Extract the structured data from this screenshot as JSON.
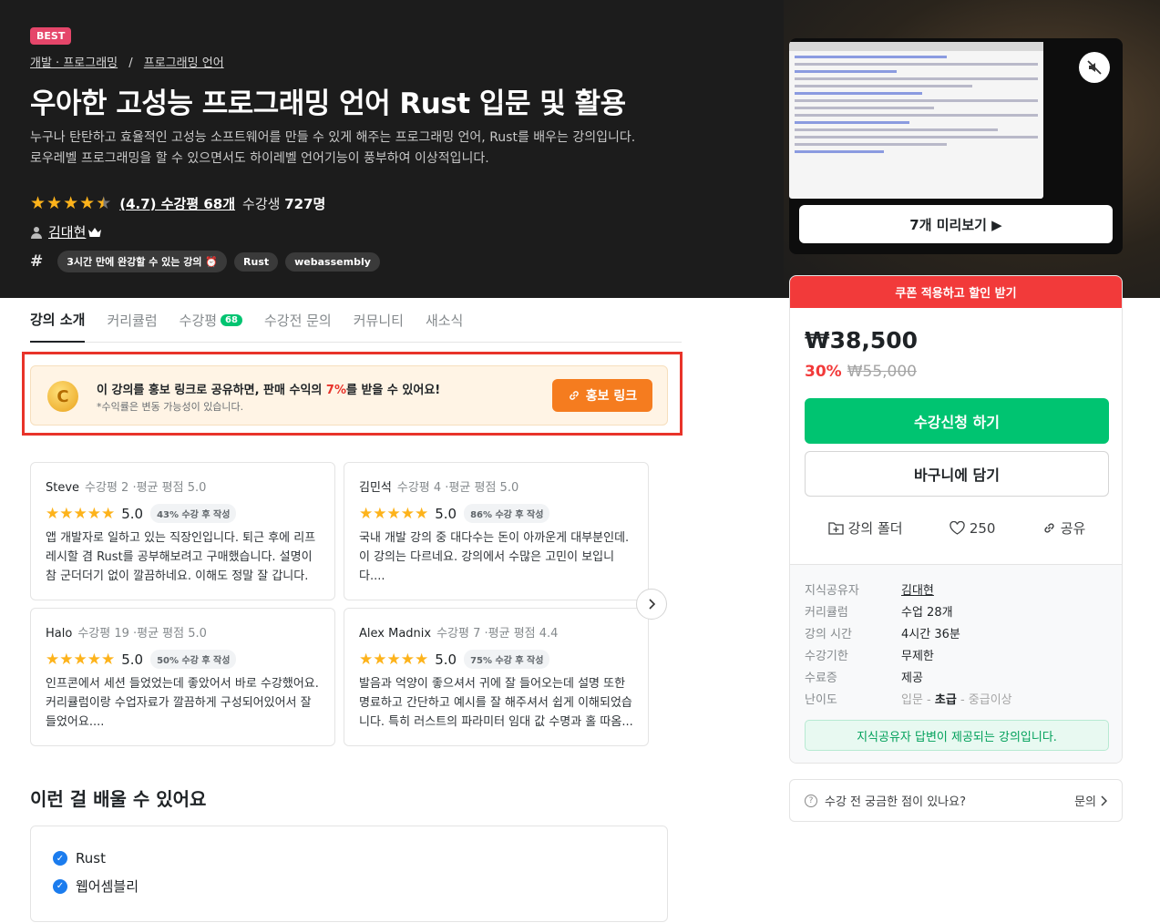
{
  "hero": {
    "badge": "BEST",
    "breadcrumb": [
      "개발 · 프로그래밍",
      "프로그래밍 언어"
    ],
    "breadcrumb_sep": "/",
    "title": "우아한 고성능 프로그래밍 언어 Rust 입문 및 활용",
    "description": "누구나 탄탄하고 효율적인 고성능 소프트웨어를 만들 수 있게 해주는 프로그래밍 언어, Rust를 배우는 강의입니다. 로우레벨 프로그래밍을 할 수 있으면서도 하이레벨 언어기능이 풍부하여 이상적입니다.",
    "rating": 4.7,
    "rating_text": "(4.7) 수강평 68개",
    "students_label": "수강생",
    "students_count": "727명",
    "instructor": "김대현",
    "crown_icon": "crown-icon",
    "tags": [
      "3시간 만에 완강할 수 있는 강의 ⏰",
      "Rust",
      "webassembly"
    ]
  },
  "video": {
    "preview_label": "7개 미리보기 ▶",
    "mute_icon": "mute-icon"
  },
  "tabs": [
    {
      "label": "강의 소개"
    },
    {
      "label": "커리큘럼"
    },
    {
      "label": "수강평",
      "count": "68"
    },
    {
      "label": "수강전 문의"
    },
    {
      "label": "커뮤니티"
    },
    {
      "label": "새소식"
    }
  ],
  "promo": {
    "text_before": "이 강의를 홍보 링크로 공유하면, 판매 수익의 ",
    "pct": "7%",
    "text_after": "를 받을 수 있어요!",
    "sub": "*수익률은 변동 가능성이 있습니다.",
    "button": "홍보 링크",
    "highlight_color": "#e8332a"
  },
  "reviews": [
    {
      "name": "Steve",
      "meta": "수강평 2 ·평균 평점 5.0",
      "score": "5.0",
      "pill": "43% 수강 후 작성",
      "body": "앱 개발자로 일하고 있는 직장인입니다. 퇴근 후에 리프레시할 겸 Rust를 공부해보려고 구매했습니다. 설명이 참 군더더기 없이 깔끔하네요. 이해도 정말 잘 갑니다. ..."
    },
    {
      "name": "김민석",
      "meta": "수강평 4 ·평균 평점 5.0",
      "score": "5.0",
      "pill": "86% 수강 후 작성",
      "body": "국내 개발 강의 중 대다수는 돈이 아까운게 대부분인데. 이 강의는 다르네요. 강의에서 수많은 고민이 보입니다...."
    },
    {
      "name": "Halo",
      "meta": "수강평 19 ·평균 평점 5.0",
      "score": "5.0",
      "pill": "50% 수강 후 작성",
      "body": "인프콘에서 세션 들었었는데 좋았어서 바로 수강했어요. 커리큘럼이랑 수업자료가 깔끔하게 구성되어있어서 잘 들었어요...."
    },
    {
      "name": "Alex Madnix",
      "meta": "수강평 7 ·평균 평점 4.4",
      "score": "5.0",
      "pill": "75% 수강 후 작성",
      "body": "발음과 억양이 좋으셔서 귀에 잘 들어오는데 설명 또한 명료하고 간단하고 예시를 잘 해주셔서 쉽게 이해되었습니다. 특히 러스트의 파라미터 임대 값 수명과 홀 따옴..."
    }
  ],
  "learn": {
    "title": "이런 걸 배울 수 있어요",
    "items": [
      "Rust",
      "웹어셈블리"
    ]
  },
  "sidebar": {
    "coupon": "쿠폰 적용하고 할인 받기",
    "price": "₩38,500",
    "discount_pct": "30%",
    "original_price": "₩55,000",
    "enroll": "수강신청 하기",
    "cart": "바구니에 담기",
    "folder": "강의 폴더",
    "likes": "250",
    "share": "공유",
    "info": [
      {
        "k": "지식공유자",
        "v": "김대현"
      },
      {
        "k": "커리큘럼",
        "v": "수업 28개"
      },
      {
        "k": "강의 시간",
        "v": "4시간 36분"
      },
      {
        "k": "수강기한",
        "v": "무제한"
      },
      {
        "k": "수료증",
        "v": "제공"
      }
    ],
    "level_key": "난이도",
    "levels": [
      "입문",
      "초급",
      "중급이상"
    ],
    "level_sep": " - ",
    "notice": "지식공유자 답변이 제공되는 강의입니다.",
    "accent": "#00c471",
    "coupon_color": "#f23a3a"
  },
  "question": {
    "text": "수강 전 궁금한 점이 있나요?",
    "link": "문의"
  }
}
